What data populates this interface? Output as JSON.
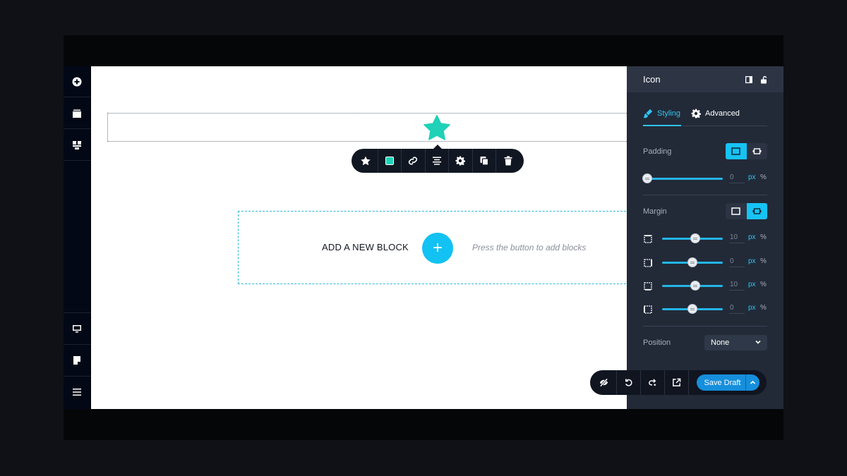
{
  "sidebar": {
    "top_icons": [
      "plus-circle-icon",
      "layers-icon",
      "blocks-icon"
    ],
    "bottom_icons": [
      "desktop-icon",
      "page-icon",
      "menu-icon"
    ]
  },
  "canvas": {
    "icon_element": {
      "icon": "star-icon",
      "color": "#1fd1b7"
    },
    "toolbar_icons": [
      "star-icon",
      "color-swatch-icon",
      "link-icon",
      "align-center-icon",
      "gear-icon",
      "copy-icon",
      "trash-icon"
    ],
    "add_block": {
      "label": "ADD A NEW BLOCK",
      "button": "+",
      "hint": "Press the button to add blocks"
    }
  },
  "panel": {
    "title": "Icon",
    "tabs": [
      {
        "label": "Styling",
        "active": true
      },
      {
        "label": "Advanced",
        "active": false
      }
    ],
    "padding": {
      "label": "Padding",
      "value": "0",
      "unit_px": "px",
      "unit_pct": "%"
    },
    "margin": {
      "label": "Margin",
      "rows": [
        {
          "side": "top",
          "value": "10",
          "unit_px": "px",
          "unit_pct": "%",
          "level": 0.55
        },
        {
          "side": "right",
          "value": "0",
          "unit_px": "px",
          "unit_pct": "%",
          "level": 0.5
        },
        {
          "side": "bottom",
          "value": "10",
          "unit_px": "px",
          "unit_pct": "%",
          "level": 0.55
        },
        {
          "side": "left",
          "value": "0",
          "unit_px": "px",
          "unit_pct": "%",
          "level": 0.5
        }
      ]
    },
    "position": {
      "label": "Position",
      "value": "None"
    }
  },
  "actionbar": {
    "icons": [
      "hide-icon",
      "undo-icon",
      "redo-icon",
      "external-link-icon"
    ],
    "save_label": "Save Draft"
  },
  "colors": {
    "accent": "#16c3f4",
    "save": "#168fdc",
    "panel": "#222a38"
  }
}
